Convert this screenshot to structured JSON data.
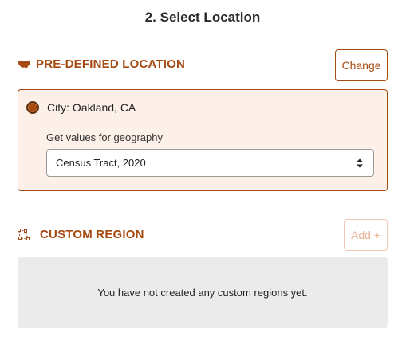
{
  "step_title": "2. Select Location",
  "predefined": {
    "heading": "PRE-DEFINED LOCATION",
    "icon": "usa-map-icon",
    "change_label": "Change",
    "selected_location": "City: Oakland, CA",
    "geo_label": "Get values for geography",
    "geo_value": "Census Tract, 2020"
  },
  "custom": {
    "heading": "CUSTOM REGION",
    "icon": "polygon-region-icon",
    "add_label": "Add +",
    "empty_message": "You have not created any custom regions yet."
  },
  "colors": {
    "accent": "#a54a12",
    "card_background": "#fdf0e8",
    "empty_background": "#ebebeb",
    "disabled_accent": "#eab396"
  }
}
